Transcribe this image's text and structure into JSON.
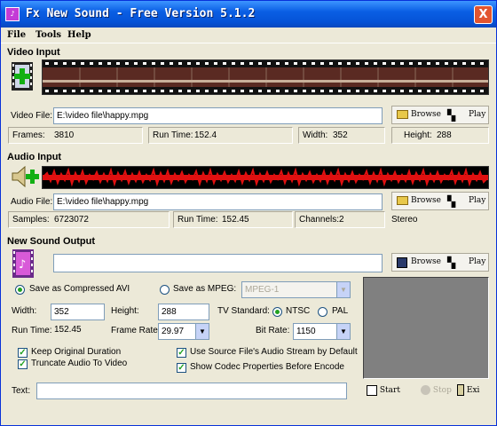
{
  "window": {
    "title": "Fx New Sound - Free Version 5.1.2",
    "close_label": "X"
  },
  "menu": [
    "File",
    "Tools",
    "Help"
  ],
  "video": {
    "section": "Video Input",
    "file_label": "Video File:",
    "file_value": "E:\\video file\\happy.mpg",
    "browse": "Browse",
    "play": "Play",
    "frames_label": "Frames:",
    "frames": "3810",
    "runtime_label": "Run Time:",
    "runtime": "152.4",
    "width_label": "Width:",
    "width": "352",
    "height_label": "Height:",
    "height": "288"
  },
  "audio": {
    "section": "Audio Input",
    "file_label": "Audio File:",
    "file_value": "E:\\video file\\happy.mpg",
    "browse": "Browse",
    "play": "Play",
    "samples_label": "Samples:",
    "samples": "6723072",
    "runtime_label": "Run Time:",
    "runtime": "152.45",
    "channels_label": "Channels:",
    "channels": "2",
    "mode": "Stereo"
  },
  "output": {
    "section": "New Sound Output",
    "file_value": "",
    "browse": "Browse",
    "play": "Play",
    "save_avi": "Save as Compressed AVI",
    "save_mpeg": "Save as MPEG:",
    "mpeg_format": "MPEG-1",
    "width_label": "Width:",
    "width": "352",
    "height_label": "Height:",
    "height": "288",
    "tv_label": "TV Standard:",
    "ntsc": "NTSC",
    "pal": "PAL",
    "runtime_label": "Run Time:",
    "runtime": "152.45",
    "framerate_label": "Frame Rate:",
    "framerate": "29.97",
    "bitrate_label": "Bit Rate:",
    "bitrate": "1150",
    "keep_original": "Keep Original Duration",
    "truncate_audio": "Truncate Audio To Video",
    "use_source_audio": "Use Source File's Audio Stream by Default",
    "show_codec": "Show Codec Properties Before Encode",
    "text_label": "Text:",
    "text_value": ""
  },
  "actions": {
    "start": "Start",
    "stop": "Stop",
    "exit": "Exi"
  },
  "colors": {
    "titlebar": "#0a5fe4",
    "waveform": "#e01010",
    "accent": "#21a121"
  }
}
